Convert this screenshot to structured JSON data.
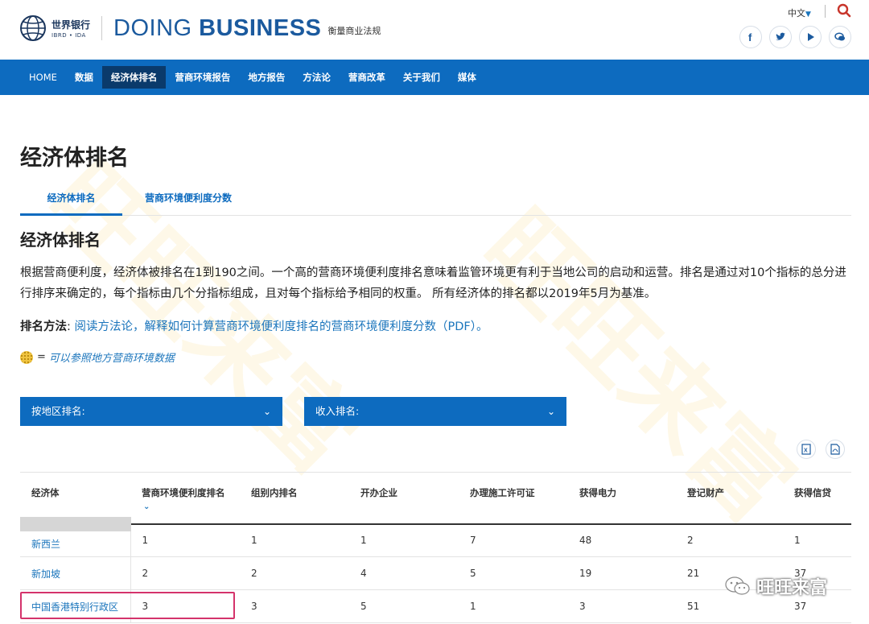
{
  "header": {
    "brand_cn": "世界银行",
    "brand_sub": "IBRD • IDA",
    "title_light": "DOING ",
    "title_bold": "BUSINESS",
    "subtitle": "衡量商业法规",
    "lang": "中文",
    "social": [
      "facebook-icon",
      "twitter-icon",
      "youtube-icon",
      "chat-icon"
    ]
  },
  "nav": {
    "items": [
      "HOME",
      "数据",
      "经济体排名",
      "营商环境报告",
      "地方报告",
      "方法论",
      "营商改革",
      "关于我们",
      "媒体"
    ],
    "active_index": 2
  },
  "main": {
    "page_title": "经济体排名",
    "tabs": [
      "经济体排名",
      "营商环境便利度分数"
    ],
    "section_title": "经济体排名",
    "description": "根据营商便利度，经济体被排名在1到190之间。一个高的营商环境便利度排名意味着监管环境更有利于当地公司的启动和运营。排名是通过对10个指标的总分进行排序来确定的，每个指标由几个分指标组成，且对每个指标给予相同的权重。 所有经济体的排名都以2019年5月为基准。",
    "method_label": "排名方法",
    "method_link": "阅读方法论，解释如何计算营商环境便利度排名的营商环境便利度分数（PDF）。",
    "legend_eq": "=",
    "legend_text": "可以参照地方营商环境数据",
    "dropdown_region": "按地区排名:",
    "dropdown_income": "收入排名:"
  },
  "table": {
    "headers": [
      "经济体",
      "营商环境便利度排名",
      "组别内排名",
      "开办企业",
      "办理施工许可证",
      "获得电力",
      "登记财产",
      "获得信贷"
    ],
    "rows": [
      [
        "新西兰",
        "1",
        "1",
        "1",
        "7",
        "48",
        "2",
        "1"
      ],
      [
        "新加坡",
        "2",
        "2",
        "4",
        "5",
        "19",
        "21",
        "37"
      ],
      [
        "中国香港特别行政区",
        "3",
        "3",
        "5",
        "1",
        "3",
        "51",
        "37"
      ]
    ]
  },
  "watermark": {
    "account": "旺旺来富"
  },
  "colors": {
    "nav_bg": "#0d6bbf",
    "nav_active": "#0a3a6b",
    "link": "#1b75bc",
    "highlight": "#d4336b"
  }
}
